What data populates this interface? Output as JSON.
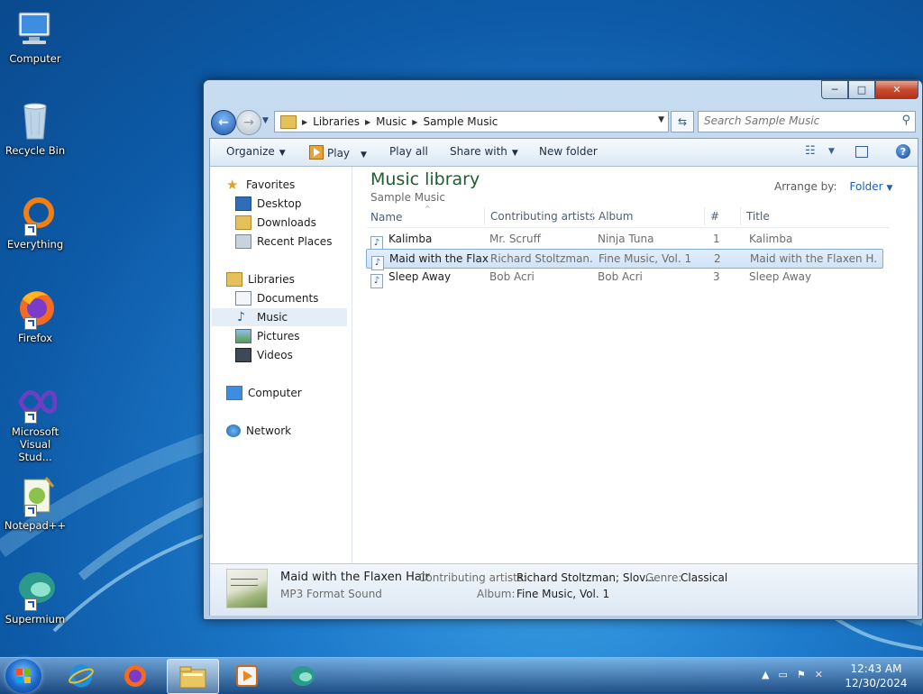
{
  "desktop": {
    "icons": [
      {
        "label": "Computer",
        "icon": "computer-icon"
      },
      {
        "label": "Recycle Bin",
        "icon": "recycle-bin-icon"
      },
      {
        "label": "Everything",
        "icon": "everything-icon"
      },
      {
        "label": "Firefox",
        "icon": "firefox-icon"
      },
      {
        "label": "Microsoft Visual Stud...",
        "icon": "visual-studio-icon"
      },
      {
        "label": "Notepad++",
        "icon": "notepad-plus-plus-icon"
      },
      {
        "label": "Supermium",
        "icon": "supermium-icon"
      }
    ]
  },
  "window": {
    "controls": {
      "minimize": "─",
      "maximize": "□",
      "close": "✕"
    },
    "breadcrumb": [
      "Libraries",
      "Music",
      "Sample Music"
    ],
    "search_placeholder": "Search Sample Music",
    "toolbar": {
      "organize": "Organize",
      "play": "Play",
      "play_all": "Play all",
      "share_with": "Share with",
      "new_folder": "New folder"
    },
    "nav": {
      "favorites": "Favorites",
      "favorites_items": [
        "Desktop",
        "Downloads",
        "Recent Places"
      ],
      "libraries": "Libraries",
      "libraries_items": [
        "Documents",
        "Music",
        "Pictures",
        "Videos"
      ],
      "selected": "Music",
      "computer": "Computer",
      "network": "Network"
    },
    "library": {
      "title": "Music library",
      "subtitle": "Sample Music",
      "arrange_label": "Arrange by:",
      "arrange_value": "Folder"
    },
    "columns": [
      "Name",
      "Contributing artists",
      "Album",
      "#",
      "Title"
    ],
    "rows": [
      {
        "name": "Kalimba",
        "artist": "Mr. Scruff",
        "album": "Ninja Tuna",
        "num": "1",
        "title": "Kalimba"
      },
      {
        "name": "Maid with the Flaxe...",
        "artist": "Richard Stoltzman...",
        "album": "Fine Music, Vol. 1",
        "num": "2",
        "title": "Maid with the Flaxen H..."
      },
      {
        "name": "Sleep Away",
        "artist": "Bob Acri",
        "album": "Bob Acri",
        "num": "3",
        "title": "Sleep Away"
      }
    ],
    "selected_row": 1,
    "details": {
      "name": "Maid with the Flaxen Hair",
      "type": "MP3 Format Sound",
      "artists_label": "Contributing artists:",
      "artists_value": "Richard Stoltzman; Slov...",
      "album_label": "Album:",
      "album_value": "Fine Music, Vol. 1",
      "genre_label": "Genre:",
      "genre_value": "Classical"
    }
  },
  "taskbar": {
    "apps": [
      "internet-explorer-icon",
      "firefox-icon",
      "file-explorer-icon",
      "media-player-icon",
      "supermium-icon"
    ],
    "active_app": "file-explorer-icon",
    "time": "12:43 AM",
    "date": "12/30/2024"
  },
  "colors": {
    "library_title": "#1e5d2e",
    "link_blue": "#1f5fb5",
    "selection_border": "#84acd8"
  }
}
